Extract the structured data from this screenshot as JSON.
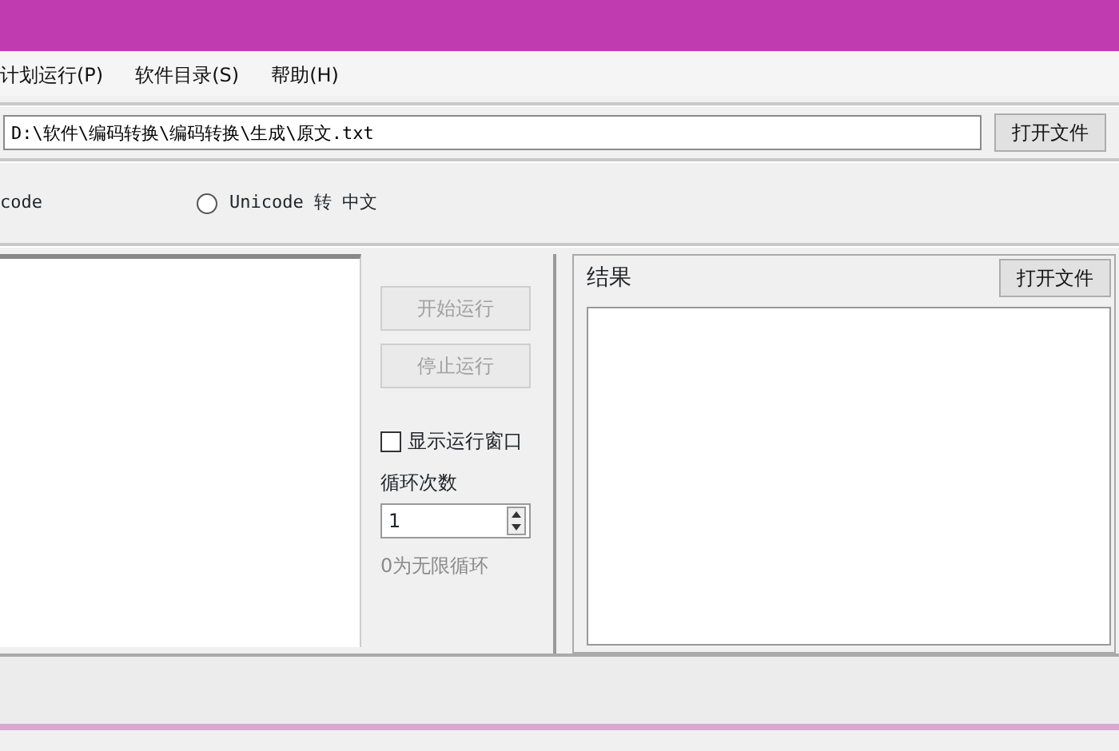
{
  "menu": [
    {
      "label": "计划运行(P)"
    },
    {
      "label": "软件目录(S)"
    },
    {
      "label": "帮助(H)"
    }
  ],
  "file_path": {
    "value": "D:\\软件\\编码转换\\编码转换\\生成\\原文.txt",
    "button": "打开文件"
  },
  "mode": {
    "cut_label": "code",
    "radio": {
      "label": "Unicode 转 中文",
      "selected": false
    }
  },
  "controls": {
    "buttons": [
      {
        "label": "开始运行",
        "disabled": true
      },
      {
        "label": "停止运行",
        "disabled": true
      }
    ],
    "show_window": {
      "label": "显示运行窗口",
      "checked": false
    },
    "loop_label": "循环次数",
    "loop_value": "1",
    "loop_hint": "0为无限循环"
  },
  "result": {
    "title": "结果",
    "button": "打开文件"
  }
}
